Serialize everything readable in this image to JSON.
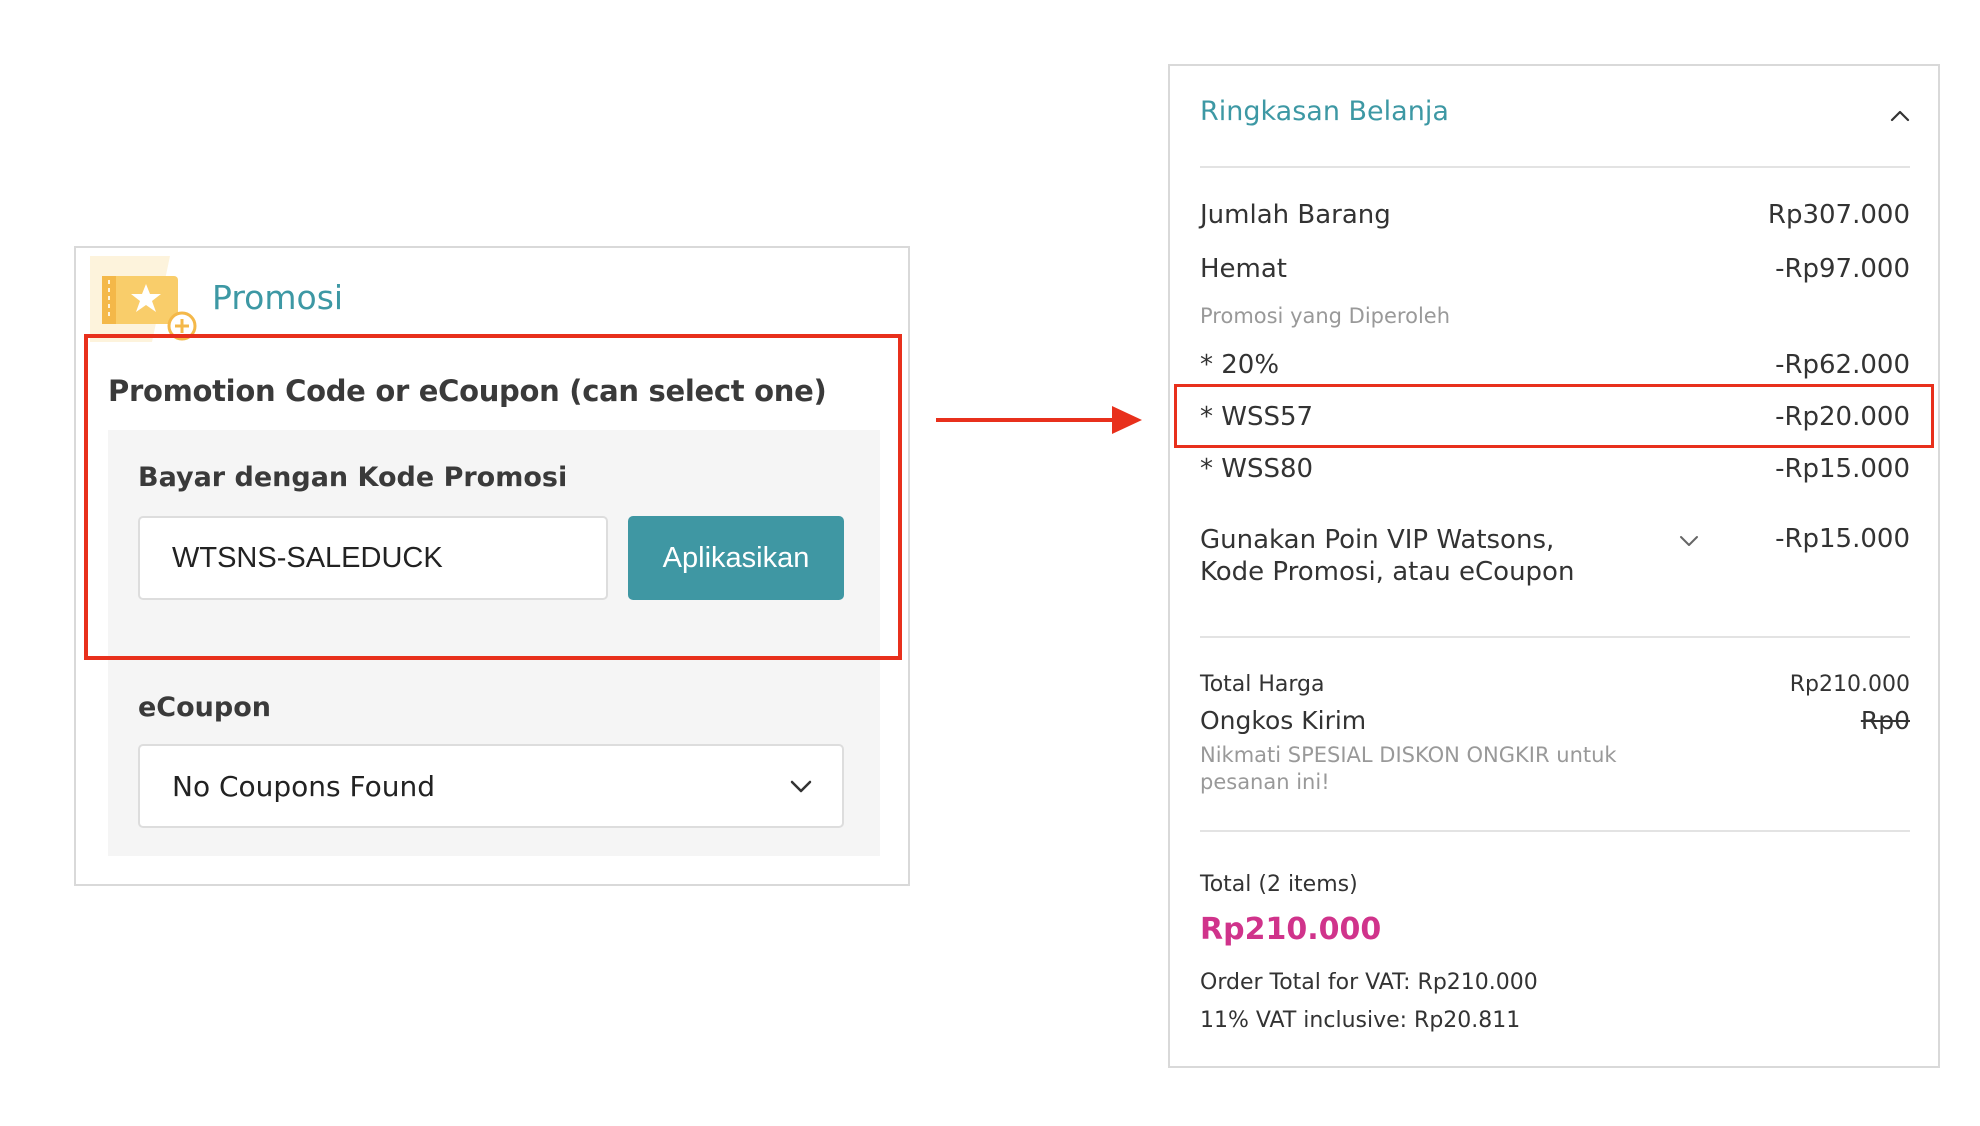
{
  "promo": {
    "title": "Promosi",
    "heading": "Promotion Code or eCoupon (can select one)",
    "code_label": "Bayar dengan Kode Promosi",
    "code_value": "WTSNS-SALEDUCK",
    "apply_label": "Aplikasikan",
    "ecoupon_label": "eCoupon",
    "ecoupon_selected": "No Coupons Found"
  },
  "summary": {
    "title": "Ringkasan Belanja",
    "items_label": "Jumlah Barang",
    "items_value": "Rp307.000",
    "saving_label": "Hemat",
    "saving_value": "-Rp97.000",
    "promos_heading": "Promosi yang Diperoleh",
    "promos": [
      {
        "label": "* 20%",
        "value": "-Rp62.000"
      },
      {
        "label": "* WSS57",
        "value": "-Rp20.000"
      },
      {
        "label": "* WSS80",
        "value": "-Rp15.000"
      }
    ],
    "vip_label": "Gunakan Poin VIP Watsons, Kode Promosi, atau eCoupon",
    "vip_value": "-Rp15.000",
    "subtotal_label": "Total Harga",
    "subtotal_value": "Rp210.000",
    "shipping_label": "Ongkos Kirim",
    "shipping_value": "Rp0",
    "shipping_note": "Nikmati SPESIAL DISKON ONGKIR untuk pesanan ini!",
    "total_label": "Total (2 items)",
    "total_value": "Rp210.000",
    "vat_total": "Order Total for VAT: Rp210.000",
    "vat_inclusive": "11% VAT inclusive: Rp20.811"
  },
  "colors": {
    "accent": "#3d98a4",
    "button": "#3f97a3",
    "highlight": "#e8301c",
    "total": "#d0338b"
  },
  "icons": {
    "promo": "ticket-star-icon",
    "dropdown": "chevron-down-icon",
    "collapse": "chevron-up-icon",
    "arrow": "arrow-right-icon"
  }
}
